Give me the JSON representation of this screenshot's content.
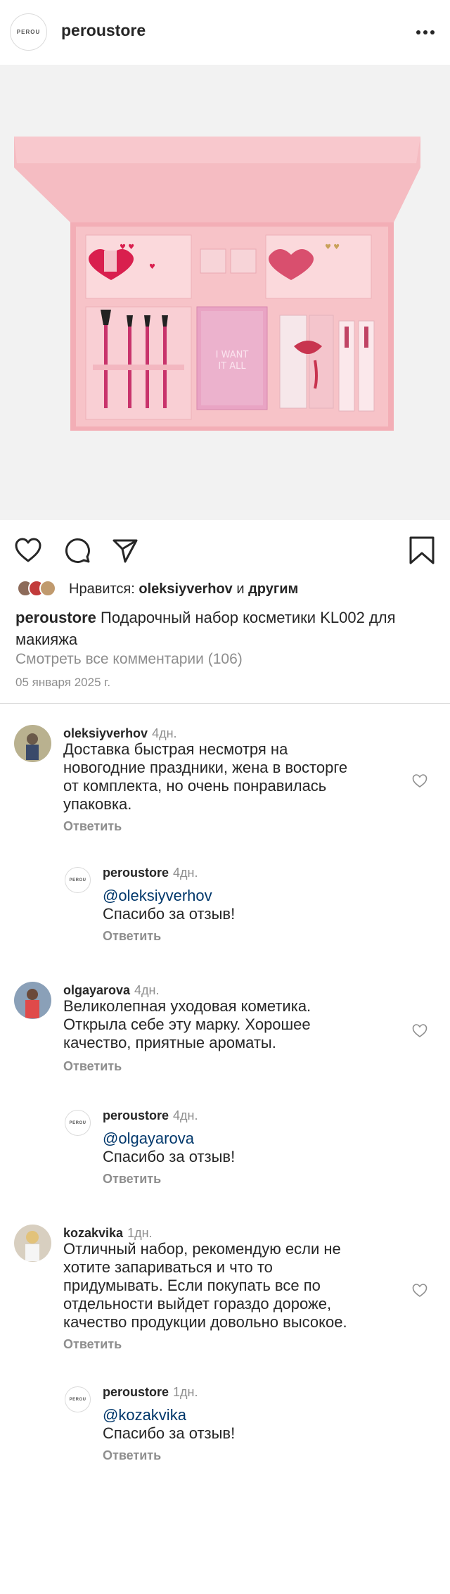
{
  "header": {
    "logo_text": "PEROU",
    "username": "peroustore"
  },
  "post": {
    "image_alt": "Подарочный набор косметики KL002",
    "image_texts": [
      "I WANT IT ALL"
    ],
    "likes_prefix": "Нравится:",
    "likes_user": "oleksiyverhov",
    "likes_middle": "и",
    "likes_others": "другим",
    "caption_user": "peroustore",
    "caption_text": "Подарочный набор косметики KL002 для макияжа",
    "view_all": "Смотреть все комментарии (106)",
    "date": "05 января 2025 г."
  },
  "comments": [
    {
      "user": "oleksiyverhov",
      "time": "4дн.",
      "lines": [
        "Доставка быстрая несмотря на",
        "новогодние праздники, жена в восторге",
        "от комплекта, но очень понравилась",
        "упаковка."
      ],
      "reply_label": "Ответить",
      "reply": {
        "user": "peroustore",
        "time": "4дн.",
        "mention": "@oleksiyverhov",
        "text": "Спасибо за отзыв!",
        "reply_label": "Ответить"
      }
    },
    {
      "user": "olgayarova",
      "time": "4дн.",
      "lines": [
        "Великолепная уходовая кометика.",
        "Открыла себе эту марку. Хорошее",
        "качество, приятные ароматы."
      ],
      "reply_label": "Ответить",
      "reply": {
        "user": "peroustore",
        "time": "4дн.",
        "mention": "@olgayarova",
        "text": "Спасибо за отзыв!",
        "reply_label": "Ответить"
      }
    },
    {
      "user": "kozakvika",
      "time": "1дн.",
      "lines": [
        "Отличный набор, рекомендую если не",
        "хотите запариваться и что то",
        "придумывать. Если покупать все по",
        "отдельности выйдет гораздо дороже,",
        "качество продукции довольно высокое."
      ],
      "reply_label": "Ответить",
      "reply": {
        "user": "peroustore",
        "time": "1дн.",
        "mention": "@kozakvika",
        "text": "Спасибо за отзыв!",
        "reply_label": "Ответить"
      }
    }
  ],
  "icons": {
    "like": "heart-icon",
    "comment": "comment-bubble-icon",
    "share": "paper-plane-icon",
    "save": "bookmark-icon",
    "more": "more-dots-icon",
    "comment_like": "heart-outline-icon"
  },
  "colors": {
    "text": "#262626",
    "secondary": "#8e8e8e",
    "mention": "#00376b",
    "divider": "#dbdbdb",
    "box_pink": "#f7c4c9"
  }
}
